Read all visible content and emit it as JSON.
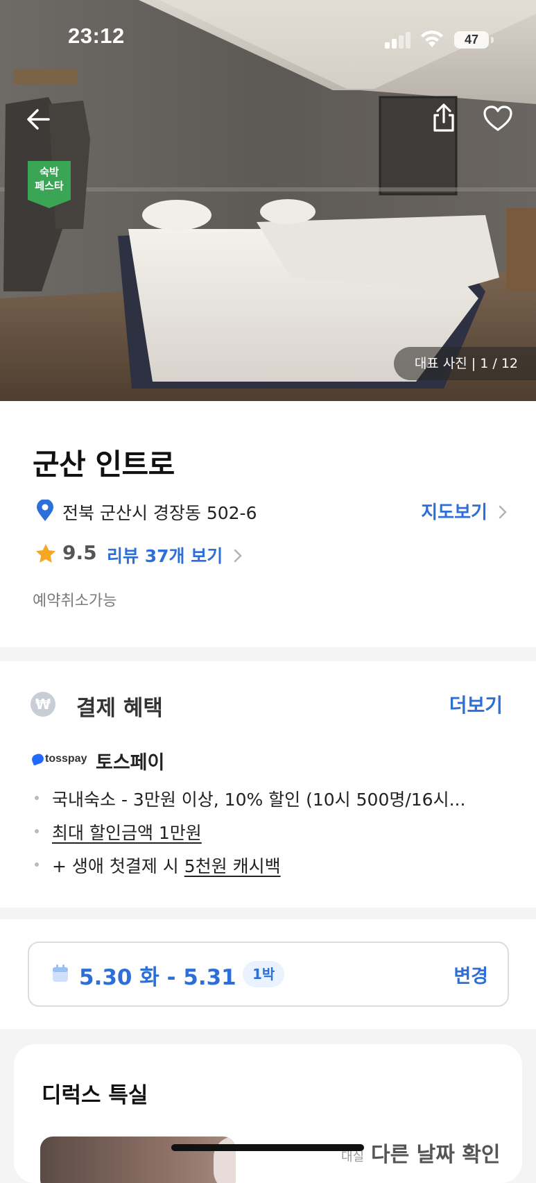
{
  "status_bar": {
    "time": "23:12",
    "battery": "47"
  },
  "hero": {
    "badge_line1": "숙박",
    "badge_line2": "페스타",
    "photo_counter": "대표 사진 | 1 / 12",
    "icons": [
      "back-arrow-icon",
      "share-icon",
      "heart-icon"
    ]
  },
  "hotel": {
    "name": "군산 인트로",
    "address": "전북 군산시 경장동 502-6",
    "map_link": "지도보기",
    "rating": "9.5",
    "reviews_link": "리뷰 37개 보기",
    "cancel_policy": "예약취소가능"
  },
  "benefit": {
    "title": "결제 혜택",
    "more": "더보기",
    "won_symbol": "₩",
    "toss_logo_text": "tosspay",
    "provider": "토스페이",
    "items": [
      "국내숙소 - 3만원 이상, 10% 할인 (10시 500명/16시...",
      "최대 할인금액 1만원",
      "+ 생애 첫결제 시 ",
      "5천원 캐시백"
    ]
  },
  "stay": {
    "dates": "5.30 화 - 5.31 수",
    "nights": "1박",
    "change": "변경"
  },
  "room": {
    "title": "디럭스 특실",
    "side_label": "대실",
    "other_dates": "다른 날짜 확인"
  },
  "colors": {
    "accent": "#2d6fd8",
    "badge_green": "#3aa655",
    "star": "#f5a623"
  }
}
